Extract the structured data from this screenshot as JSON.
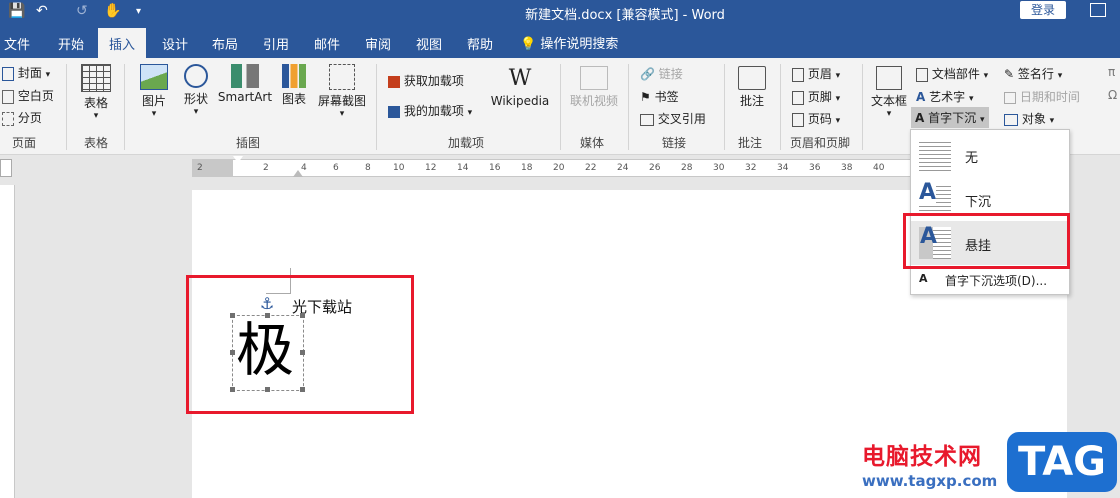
{
  "titlebar": {
    "doc_title": "新建文档.docx [兼容模式]  -  Word",
    "login": "登录"
  },
  "tabs": [
    "文件",
    "开始",
    "插入",
    "设计",
    "布局",
    "引用",
    "邮件",
    "审阅",
    "视图",
    "帮助"
  ],
  "active_tab": "插入",
  "tellme": "操作说明搜索",
  "ribbon": {
    "pages": {
      "label": "页面",
      "items": [
        "封面",
        "空白页",
        "分页"
      ]
    },
    "tables": {
      "label": "表格",
      "button": "表格"
    },
    "illustrations": {
      "label": "插图",
      "buttons": [
        "图片",
        "形状",
        "SmartArt",
        "图表",
        "屏幕截图"
      ]
    },
    "addins": {
      "label": "加载项",
      "items": [
        "获取加载项",
        "我的加载项"
      ],
      "wikipedia": "Wikipedia"
    },
    "media": {
      "label": "媒体",
      "button": "联机视频"
    },
    "links": {
      "label": "链接",
      "items": [
        "链接",
        "书签",
        "交叉引用"
      ]
    },
    "comments": {
      "label": "批注",
      "button": "批注"
    },
    "header_footer": {
      "label": "页眉和页脚",
      "items": [
        "页眉",
        "页脚",
        "页码"
      ]
    },
    "text": {
      "textbox": "文本框",
      "items": [
        "文档部件",
        "艺术字",
        "首字下沉"
      ],
      "items2": [
        "签名行",
        "日期和时间",
        "对象"
      ]
    }
  },
  "ruler_ticks": [
    "2",
    "2",
    "4",
    "6",
    "8",
    "10",
    "12",
    "14",
    "16",
    "18",
    "20",
    "22",
    "24",
    "26",
    "28",
    "30",
    "32",
    "34",
    "36",
    "38",
    "40"
  ],
  "document": {
    "text": "光下载站",
    "dropcap": "极"
  },
  "dropcap_menu": {
    "items": [
      "无",
      "下沉",
      "悬挂"
    ],
    "options": "首字下沉选项(D)..."
  },
  "watermark": {
    "cn": "电脑技术网",
    "url": "www.tagxp.com",
    "tag": "TAG"
  }
}
